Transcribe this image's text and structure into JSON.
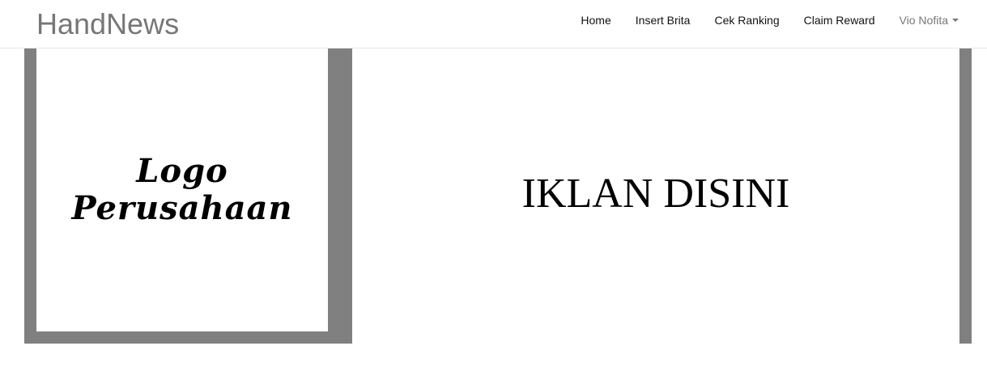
{
  "navbar": {
    "brand": "HandNews",
    "items": [
      {
        "label": "Home"
      },
      {
        "label": "Insert Brita"
      },
      {
        "label": "Cek Ranking"
      },
      {
        "label": "Claim Reward"
      }
    ],
    "user": {
      "label": "Vio Nofita",
      "icon": "caret-down-icon"
    }
  },
  "logo": {
    "line1": "Logo",
    "line2": "Perusahaan"
  },
  "ad": {
    "text": "IKLAN DISINI"
  },
  "colors": {
    "panel_gray": "#808080",
    "brand_text": "#777777",
    "nav_text": "#111111"
  }
}
